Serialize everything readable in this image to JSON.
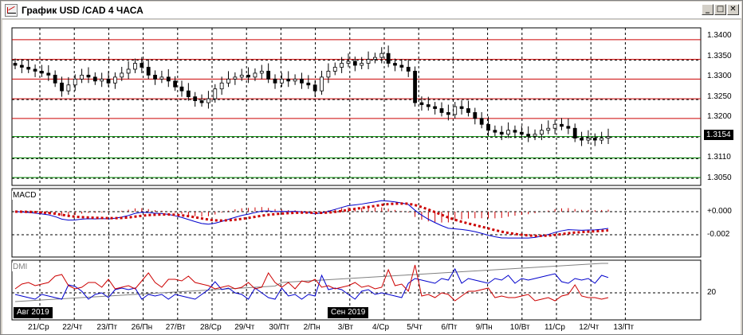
{
  "window": {
    "title": "График USD /CAD  4 ЧАСА",
    "controls": [
      "_",
      "□",
      "✕"
    ]
  },
  "price_pane": {
    "current_price": "1.3154",
    "y_labels": [
      "1.3400",
      "1.3350",
      "1.3300",
      "1.3250",
      "1.3200",
      "1.3150",
      "1.3110",
      "1.3050"
    ]
  },
  "macd_pane": {
    "label": "MACD",
    "y_labels": [
      "+0.000",
      "-0.002"
    ]
  },
  "dmi_pane": {
    "label": "DMI",
    "y_labels": [
      "20"
    ]
  },
  "x_axis": {
    "month_tags": [
      "Авг 2019",
      "Сен 2019"
    ],
    "ticks": [
      "21/Ср",
      "22/Чт",
      "23/Пт",
      "26/Пн",
      "27/Вт",
      "28/Ср",
      "29/Чт",
      "30/Пт",
      "2/Пн",
      "3/Вт",
      "4/Ср",
      "5/Чт",
      "6/Пт",
      "9/Пн",
      "10/Вт",
      "11/Ср",
      "12/Чт",
      "13/Пт"
    ]
  },
  "colors": {
    "up": "#ffffff",
    "down": "#000000",
    "macd_line": "#0000cc",
    "macd_signal": "#cc0000",
    "dmi_plus": "#0000cc",
    "dmi_minus": "#cc0000",
    "adx": "#808080"
  },
  "chart_data": {
    "type": "candlestick",
    "price_range": [
      1.303,
      1.343
    ],
    "closes": [
      1.3335,
      1.333,
      1.3325,
      1.332,
      1.3315,
      1.331,
      1.329,
      1.327,
      1.3285,
      1.33,
      1.331,
      1.3305,
      1.3295,
      1.33,
      1.329,
      1.3305,
      1.3315,
      1.3325,
      1.334,
      1.333,
      1.331,
      1.33,
      1.3305,
      1.3295,
      1.328,
      1.327,
      1.3255,
      1.3245,
      1.324,
      1.325,
      1.3275,
      1.329,
      1.33,
      1.3305,
      1.331,
      1.3305,
      1.3315,
      1.332,
      1.33,
      1.329,
      1.33,
      1.3295,
      1.33,
      1.329,
      1.3285,
      1.327,
      1.3305,
      1.332,
      1.333,
      1.334,
      1.3345,
      1.3335,
      1.334,
      1.335,
      1.3355,
      1.3365,
      1.334,
      1.3335,
      1.333,
      1.332,
      1.324,
      1.3235,
      1.323,
      1.3225,
      1.3215,
      1.321,
      1.323,
      1.3225,
      1.3215,
      1.32,
      1.3185,
      1.317,
      1.3165,
      1.316,
      1.317,
      1.3165,
      1.316,
      1.3155,
      1.316,
      1.317,
      1.3175,
      1.3185,
      1.318,
      1.3175,
      1.315,
      1.3145,
      1.315,
      1.3145,
      1.315,
      1.3154
    ]
  }
}
